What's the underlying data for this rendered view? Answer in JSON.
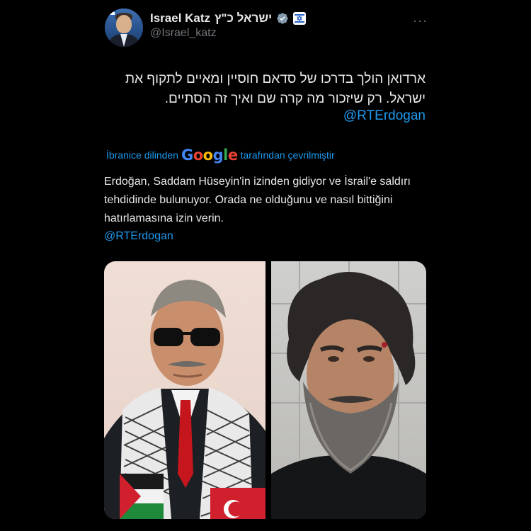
{
  "author": {
    "display_name": "Israel Katz",
    "hebrew_name": "ישראל כ\"ץ",
    "handle": "@Israel_katz",
    "verified_icon": "verified-badge-icon",
    "affiliation_icon": "israel-gov-emblem-icon"
  },
  "more_label": "···",
  "tweet": {
    "hebrew_text": "ארדואן הולך בדרכו של סדאם חוסיין ומאיים לתקוף את ישראל. רק שיזכור מה קרה שם ואיך זה הסתיים.",
    "hebrew_mention": "@RTErdogan"
  },
  "translation": {
    "prefix": "İbranice dilinden",
    "provider": "Google",
    "suffix": "tarafından çevrilmiştir",
    "text": "Erdoğan, Saddam Hüseyin'in izinden gidiyor ve İsrail'e saldırı tehdidinde bulunuyor. Orada ne olduğunu ve nasıl bittiğini hatırlamasına izin verin.",
    "mention": "@RTErdogan"
  },
  "media": {
    "left_image": "erdogan-photo",
    "right_image": "saddam-photo"
  },
  "colors": {
    "background": "#000000",
    "text": "#e7e9ea",
    "muted": "#71767b",
    "link": "#1d9bf0"
  }
}
